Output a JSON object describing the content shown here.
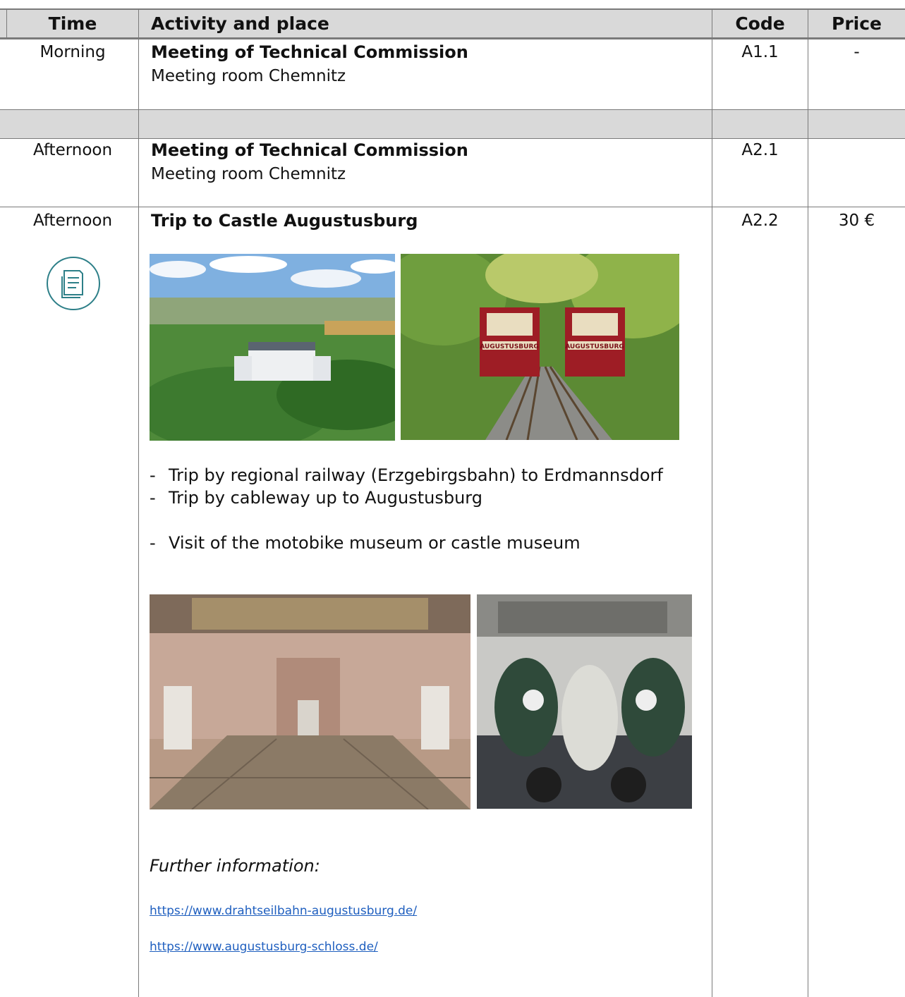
{
  "header": {
    "time": "Time",
    "activity": "Activity and place",
    "code": "Code",
    "price": "Price"
  },
  "rows": [
    {
      "time": "Morning",
      "title": "Meeting of Technical Commission",
      "place": "Meeting room Chemnitz",
      "code": "A1.1",
      "price": "-"
    },
    {
      "time": "Afternoon",
      "title": "Meeting of Technical Commission",
      "place": "Meeting room Chemnitz",
      "code": "A2.1",
      "price": ""
    },
    {
      "time": "Afternoon",
      "title": "Trip to Castle Augustusburg",
      "code": "A2.2",
      "price": "30 €",
      "bullets": [
        "Trip by regional railway (Erzgebirgsbahn) to Erdmannsdorf",
        "Trip by cableway up to Augustusburg",
        "Visit of the motobike museum or castle museum"
      ],
      "bullet_dash": "-",
      "further_label": "Further information:",
      "links": [
        "https://www.drahtseilbahn-augustusburg.de/",
        "https://www.augustusburg-schloss.de/"
      ],
      "ticket_icon": "ticket-icon",
      "photo_labels": {
        "railcar_sign": "AUGUSTUSBURG"
      }
    }
  ],
  "colors": {
    "grid": "#7a7a7a",
    "header_bg": "#d9d9d9",
    "link": "#1f5fbf",
    "icon": "#2d7f88"
  }
}
